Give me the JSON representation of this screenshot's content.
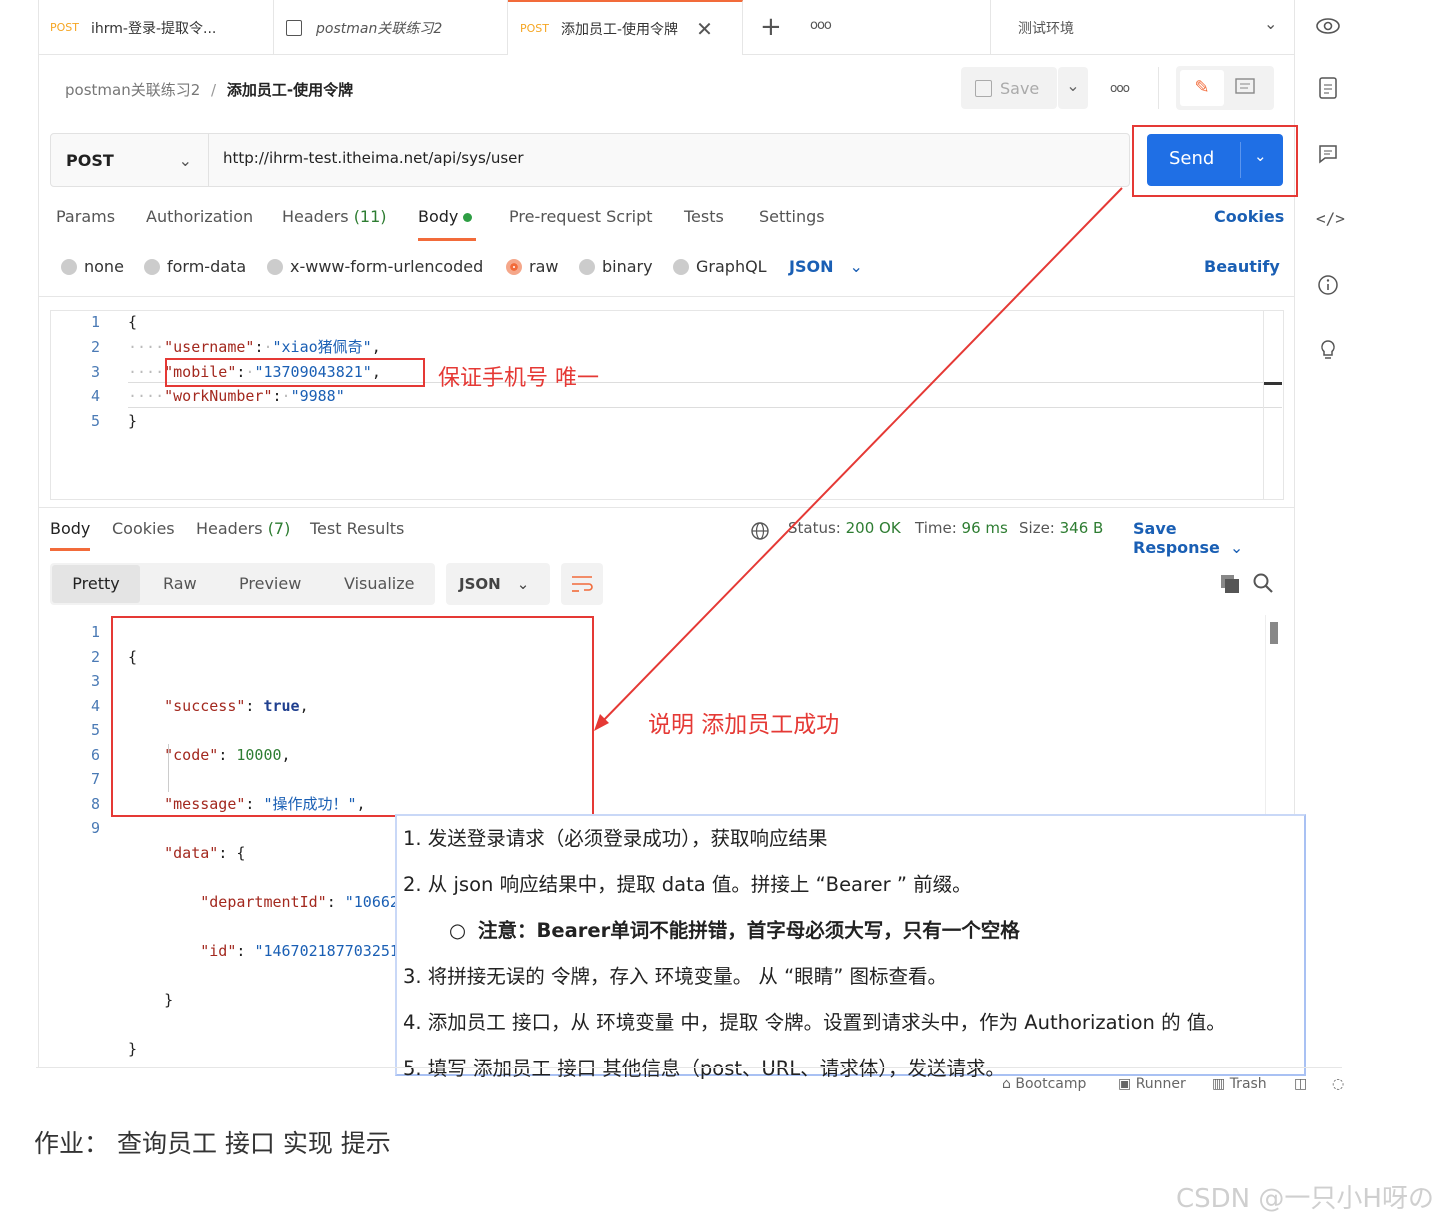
{
  "tabs": [
    {
      "method": "POST",
      "label": "ihrm-登录-提取令..."
    },
    {
      "method": "",
      "label": "postman关联练习2"
    },
    {
      "method": "POST",
      "label": "添加员工-使用令牌"
    }
  ],
  "tab_add": "+",
  "tab_more": "ooo",
  "environment": "测试环境",
  "breadcrumb": {
    "parent": "postman关联练习2",
    "sep": "/",
    "current": "添加员工-使用令牌"
  },
  "toolbar": {
    "save": "Save",
    "more": "ooo"
  },
  "request": {
    "method": "POST",
    "url": "http://ihrm-test.itheima.net/api/sys/user",
    "send": "Send"
  },
  "req_tabs": {
    "params": "Params",
    "authorization": "Authorization",
    "headers": "Headers",
    "headers_count": "(11)",
    "body": "Body",
    "prerequest": "Pre-request Script",
    "tests": "Tests",
    "settings": "Settings",
    "cookies": "Cookies"
  },
  "body_types": {
    "none": "none",
    "form_data": "form-data",
    "urlencoded": "x-www-form-urlencoded",
    "raw": "raw",
    "binary": "binary",
    "graphql": "GraphQL",
    "json": "JSON",
    "beautify": "Beautify"
  },
  "req_body": [
    {
      "n": "1",
      "t": "{"
    },
    {
      "n": "2",
      "k": "\"username\"",
      "v": "\"xiao猪佩奇\"",
      "e": ","
    },
    {
      "n": "3",
      "k": "\"mobile\"",
      "v": "\"13709043821\"",
      "e": ","
    },
    {
      "n": "4",
      "k": "\"workNumber\"",
      "v": "\"9988\"",
      "e": ""
    },
    {
      "n": "5",
      "t": "}"
    }
  ],
  "annot_mobile": "保证手机号 唯一",
  "resp_tabs": {
    "body": "Body",
    "cookies": "Cookies",
    "headers": "Headers",
    "headers_count": "(7)",
    "test_results": "Test Results"
  },
  "resp_status": {
    "status_label": "Status:",
    "status": "200 OK",
    "time_label": "Time:",
    "time": "96 ms",
    "size_label": "Size:",
    "size": "346 B",
    "save_response": "Save Response"
  },
  "view_modes": {
    "pretty": "Pretty",
    "raw": "Raw",
    "preview": "Preview",
    "visualize": "Visualize",
    "format": "JSON"
  },
  "resp_lines": [
    "1",
    "2",
    "3",
    "4",
    "5",
    "6",
    "7",
    "8",
    "9"
  ],
  "resp_body": {
    "open": "{",
    "success_k": "\"success\"",
    "success_v": "true",
    "code_k": "\"code\"",
    "code_v": "10000",
    "message_k": "\"message\"",
    "message_v": "\"操作成功！\"",
    "data_k": "\"data\"",
    "data_open": "{",
    "dept_k": "\"departmentId\"",
    "dept_v": "\"1066239913642561536\"",
    "id_k": "\"id\"",
    "id_v": "\"1467021877032517632\"",
    "data_close": "}",
    "close": "}"
  },
  "annot_success": "说明 添加员工成功",
  "notes": {
    "n1": "1.  发送登录请求（必须登录成功），获取响应结果",
    "n2": "2.  从 json 响应结果中，提取 data 值。拼接上 “Bearer ” 前缀。",
    "n2_sub": "注意：Bearer单词不能拼错，首字母必须大写，只有一个空格",
    "n3": "3.  将拼接无误的 令牌，存入 环境变量。 从 “眼睛” 图标查看。",
    "n4": "4.  添加员工 接口，从 环境变量 中，提取 令牌。设置到请求头中，作为 Authorization 的 值。",
    "n5": "5.  填写 添加员工 接口 其他信息（post、URL、请求体），发送请求。"
  },
  "footer": {
    "bootcamp": "Bootcamp",
    "runner": "Runner",
    "trash": "Trash"
  },
  "homework": "作业：  查询员工 接口 实现 提示",
  "watermark": "CSDN @一只小H呀の",
  "colors": {
    "send": "#1f6fe5",
    "annotation": "#e53935",
    "link": "#1a5fb4",
    "status_ok": "#2e7d32"
  }
}
